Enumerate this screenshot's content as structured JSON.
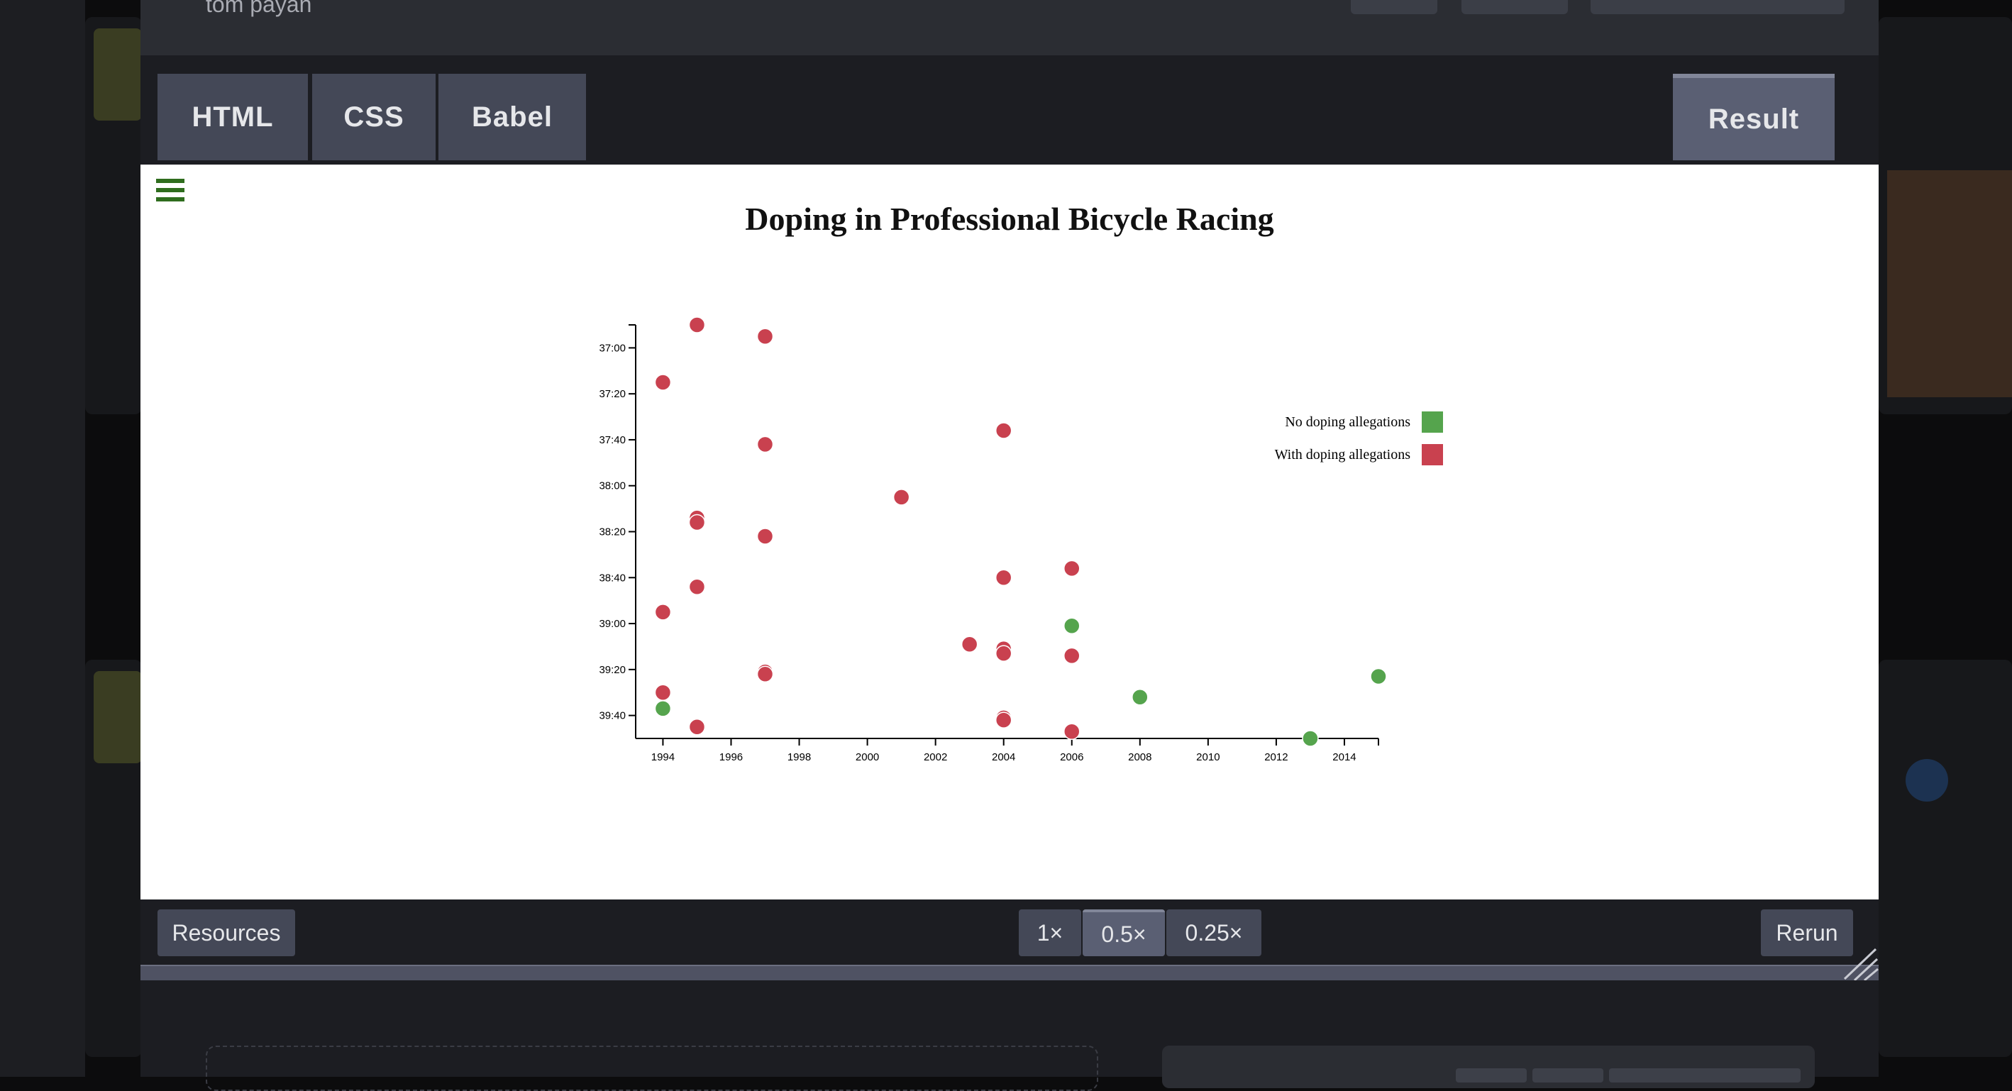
{
  "author": "tom payan",
  "editor_tabs": [
    "HTML",
    "CSS",
    "Babel"
  ],
  "result_tab": "Result",
  "resources_label": "Resources",
  "zoom_options": [
    "1×",
    "0.5×",
    "0.25×"
  ],
  "zoom_selected": "0.5×",
  "rerun_label": "Rerun",
  "menu_icon": "hamburger-menu-icon",
  "colors": {
    "menu_icon": "#2f6d1e",
    "no_doping": "#55a44d",
    "doping": "#c9414f"
  },
  "chart_data": {
    "type": "scatter",
    "title": "Doping in Professional Bicycle Racing",
    "xlabel": "",
    "ylabel": "",
    "x_ticks": [
      "1994",
      "1996",
      "1998",
      "2000",
      "2002",
      "2004",
      "2006",
      "2008",
      "2010",
      "2012",
      "2014"
    ],
    "y_ticks": [
      "37:00",
      "37:20",
      "37:40",
      "38:00",
      "38:20",
      "38:40",
      "39:00",
      "39:20",
      "39:40"
    ],
    "xlim": [
      1993.2,
      2015
    ],
    "ylim_seconds": [
      2210,
      2390
    ],
    "y_inverted": true,
    "legend": [
      {
        "label": "No doping allegations",
        "color": "#55a44d"
      },
      {
        "label": "With doping allegations",
        "color": "#c9414f"
      }
    ],
    "legend_position": "right",
    "series": [
      {
        "name": "With doping allegations",
        "color": "#c9414f",
        "points": [
          {
            "year": 1995,
            "time": "36:50"
          },
          {
            "year": 1997,
            "time": "36:55"
          },
          {
            "year": 1994,
            "time": "37:15"
          },
          {
            "year": 1997,
            "time": "37:42"
          },
          {
            "year": 2004,
            "time": "37:36"
          },
          {
            "year": 2001,
            "time": "38:05"
          },
          {
            "year": 1995,
            "time": "38:14"
          },
          {
            "year": 1995,
            "time": "38:16"
          },
          {
            "year": 1997,
            "time": "38:22"
          },
          {
            "year": 2006,
            "time": "38:36"
          },
          {
            "year": 2004,
            "time": "38:40"
          },
          {
            "year": 1995,
            "time": "38:44"
          },
          {
            "year": 1994,
            "time": "38:55"
          },
          {
            "year": 2003,
            "time": "39:09"
          },
          {
            "year": 2004,
            "time": "39:11"
          },
          {
            "year": 2004,
            "time": "39:13"
          },
          {
            "year": 2006,
            "time": "39:14"
          },
          {
            "year": 1997,
            "time": "39:21"
          },
          {
            "year": 1997,
            "time": "39:22"
          },
          {
            "year": 1994,
            "time": "39:30"
          },
          {
            "year": 2004,
            "time": "39:41"
          },
          {
            "year": 2004,
            "time": "39:42"
          },
          {
            "year": 1995,
            "time": "39:45"
          },
          {
            "year": 2006,
            "time": "39:47"
          }
        ]
      },
      {
        "name": "No doping allegations",
        "color": "#55a44d",
        "points": [
          {
            "year": 2006,
            "time": "39:01"
          },
          {
            "year": 2015,
            "time": "39:23"
          },
          {
            "year": 2008,
            "time": "39:32"
          },
          {
            "year": 1994,
            "time": "39:37"
          },
          {
            "year": 2013,
            "time": "39:50"
          }
        ]
      }
    ]
  }
}
